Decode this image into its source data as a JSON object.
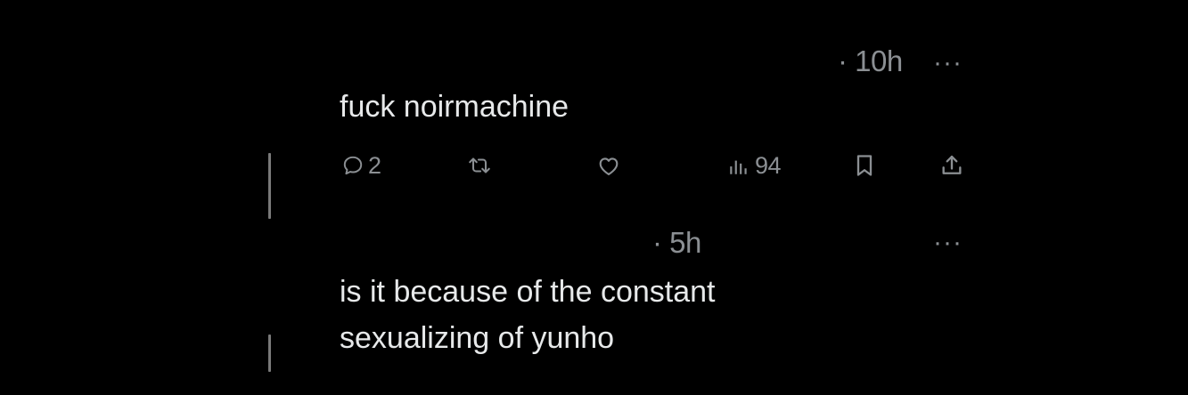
{
  "reply1": {
    "time": "· 10h",
    "more": "···",
    "text": "fuck noirmachine",
    "actions": {
      "replies": "2",
      "views": "94"
    },
    "icons": [
      "comment-icon",
      "retweet-icon",
      "like-icon",
      "views-icon",
      "bookmark-icon",
      "share-icon"
    ]
  },
  "reply2": {
    "time": "· 5h",
    "more": "···",
    "text_lines": [
      "is it because of the constant",
      "sexualizing of yunho"
    ]
  },
  "colors": {
    "background": "#000000",
    "text": "#e7e9ea",
    "muted": "#8b8f93",
    "thread_line": "#7a7a7a"
  }
}
